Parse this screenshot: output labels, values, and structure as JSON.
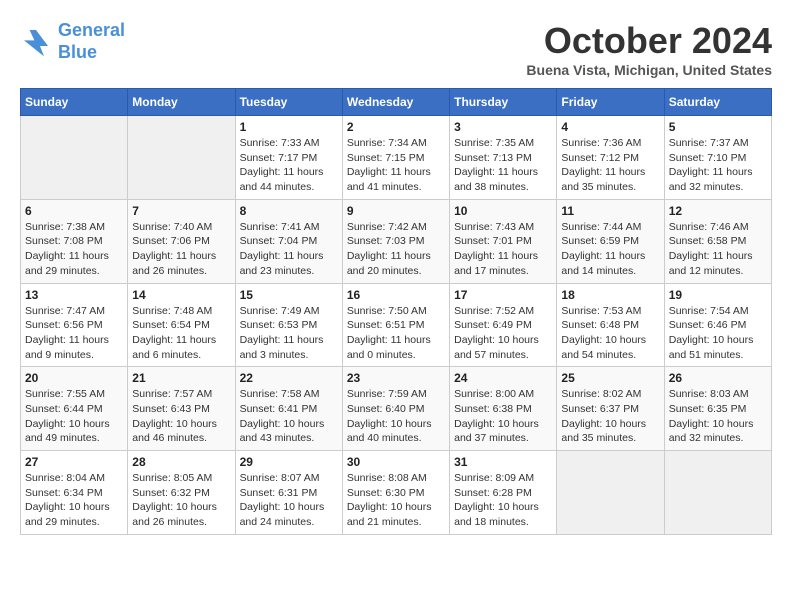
{
  "logo": {
    "line1": "General",
    "line2": "Blue"
  },
  "title": "October 2024",
  "location": "Buena Vista, Michigan, United States",
  "weekdays": [
    "Sunday",
    "Monday",
    "Tuesday",
    "Wednesday",
    "Thursday",
    "Friday",
    "Saturday"
  ],
  "weeks": [
    [
      {
        "day": "",
        "info": ""
      },
      {
        "day": "",
        "info": ""
      },
      {
        "day": "1",
        "info": "Sunrise: 7:33 AM\nSunset: 7:17 PM\nDaylight: 11 hours and 44 minutes."
      },
      {
        "day": "2",
        "info": "Sunrise: 7:34 AM\nSunset: 7:15 PM\nDaylight: 11 hours and 41 minutes."
      },
      {
        "day": "3",
        "info": "Sunrise: 7:35 AM\nSunset: 7:13 PM\nDaylight: 11 hours and 38 minutes."
      },
      {
        "day": "4",
        "info": "Sunrise: 7:36 AM\nSunset: 7:12 PM\nDaylight: 11 hours and 35 minutes."
      },
      {
        "day": "5",
        "info": "Sunrise: 7:37 AM\nSunset: 7:10 PM\nDaylight: 11 hours and 32 minutes."
      }
    ],
    [
      {
        "day": "6",
        "info": "Sunrise: 7:38 AM\nSunset: 7:08 PM\nDaylight: 11 hours and 29 minutes."
      },
      {
        "day": "7",
        "info": "Sunrise: 7:40 AM\nSunset: 7:06 PM\nDaylight: 11 hours and 26 minutes."
      },
      {
        "day": "8",
        "info": "Sunrise: 7:41 AM\nSunset: 7:04 PM\nDaylight: 11 hours and 23 minutes."
      },
      {
        "day": "9",
        "info": "Sunrise: 7:42 AM\nSunset: 7:03 PM\nDaylight: 11 hours and 20 minutes."
      },
      {
        "day": "10",
        "info": "Sunrise: 7:43 AM\nSunset: 7:01 PM\nDaylight: 11 hours and 17 minutes."
      },
      {
        "day": "11",
        "info": "Sunrise: 7:44 AM\nSunset: 6:59 PM\nDaylight: 11 hours and 14 minutes."
      },
      {
        "day": "12",
        "info": "Sunrise: 7:46 AM\nSunset: 6:58 PM\nDaylight: 11 hours and 12 minutes."
      }
    ],
    [
      {
        "day": "13",
        "info": "Sunrise: 7:47 AM\nSunset: 6:56 PM\nDaylight: 11 hours and 9 minutes."
      },
      {
        "day": "14",
        "info": "Sunrise: 7:48 AM\nSunset: 6:54 PM\nDaylight: 11 hours and 6 minutes."
      },
      {
        "day": "15",
        "info": "Sunrise: 7:49 AM\nSunset: 6:53 PM\nDaylight: 11 hours and 3 minutes."
      },
      {
        "day": "16",
        "info": "Sunrise: 7:50 AM\nSunset: 6:51 PM\nDaylight: 11 hours and 0 minutes."
      },
      {
        "day": "17",
        "info": "Sunrise: 7:52 AM\nSunset: 6:49 PM\nDaylight: 10 hours and 57 minutes."
      },
      {
        "day": "18",
        "info": "Sunrise: 7:53 AM\nSunset: 6:48 PM\nDaylight: 10 hours and 54 minutes."
      },
      {
        "day": "19",
        "info": "Sunrise: 7:54 AM\nSunset: 6:46 PM\nDaylight: 10 hours and 51 minutes."
      }
    ],
    [
      {
        "day": "20",
        "info": "Sunrise: 7:55 AM\nSunset: 6:44 PM\nDaylight: 10 hours and 49 minutes."
      },
      {
        "day": "21",
        "info": "Sunrise: 7:57 AM\nSunset: 6:43 PM\nDaylight: 10 hours and 46 minutes."
      },
      {
        "day": "22",
        "info": "Sunrise: 7:58 AM\nSunset: 6:41 PM\nDaylight: 10 hours and 43 minutes."
      },
      {
        "day": "23",
        "info": "Sunrise: 7:59 AM\nSunset: 6:40 PM\nDaylight: 10 hours and 40 minutes."
      },
      {
        "day": "24",
        "info": "Sunrise: 8:00 AM\nSunset: 6:38 PM\nDaylight: 10 hours and 37 minutes."
      },
      {
        "day": "25",
        "info": "Sunrise: 8:02 AM\nSunset: 6:37 PM\nDaylight: 10 hours and 35 minutes."
      },
      {
        "day": "26",
        "info": "Sunrise: 8:03 AM\nSunset: 6:35 PM\nDaylight: 10 hours and 32 minutes."
      }
    ],
    [
      {
        "day": "27",
        "info": "Sunrise: 8:04 AM\nSunset: 6:34 PM\nDaylight: 10 hours and 29 minutes."
      },
      {
        "day": "28",
        "info": "Sunrise: 8:05 AM\nSunset: 6:32 PM\nDaylight: 10 hours and 26 minutes."
      },
      {
        "day": "29",
        "info": "Sunrise: 8:07 AM\nSunset: 6:31 PM\nDaylight: 10 hours and 24 minutes."
      },
      {
        "day": "30",
        "info": "Sunrise: 8:08 AM\nSunset: 6:30 PM\nDaylight: 10 hours and 21 minutes."
      },
      {
        "day": "31",
        "info": "Sunrise: 8:09 AM\nSunset: 6:28 PM\nDaylight: 10 hours and 18 minutes."
      },
      {
        "day": "",
        "info": ""
      },
      {
        "day": "",
        "info": ""
      }
    ]
  ]
}
